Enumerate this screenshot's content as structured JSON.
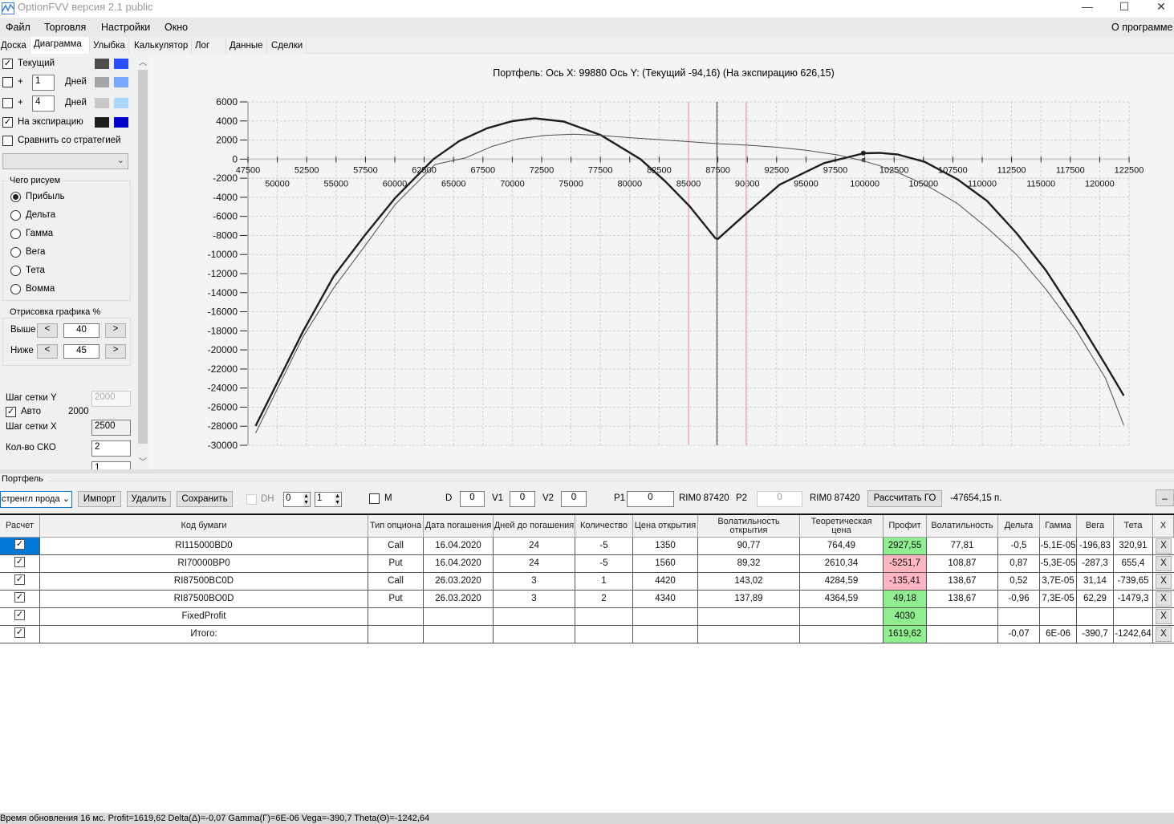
{
  "window": {
    "title": "OptionFVV версия 2.1 public",
    "minimize": "—",
    "maximize": "☐",
    "close": "✕"
  },
  "menu": {
    "items": [
      "Файл",
      "Торговля",
      "Настройки",
      "Окно"
    ],
    "about": "О программе"
  },
  "tabs": [
    "Доска",
    "Диаграмма",
    "Улыбка",
    "Калькулятор",
    "Лог",
    "Данные",
    "Сделки"
  ],
  "active_tab": "Диаграмма",
  "left_panel": {
    "curves": [
      {
        "checked": true,
        "label": "Текущий",
        "colors": [
          "#4d4d4d",
          "#2a4fff"
        ]
      },
      {
        "checked": false,
        "plus": "+",
        "days": "1",
        "days_label": "Дней",
        "colors": [
          "#a6a6a6",
          "#7aa7ff"
        ]
      },
      {
        "checked": false,
        "plus": "+",
        "days": "4",
        "days_label": "Дней",
        "colors": [
          "#c8c8c8",
          "#aad7ff"
        ]
      },
      {
        "checked": true,
        "label": "На экспирацию",
        "colors": [
          "#1e1e1e",
          "#0000c8"
        ]
      }
    ],
    "compare": {
      "checked": false,
      "label": "Сравнить со стратегией"
    },
    "strategy_select": "",
    "what_group": {
      "title": "Чего рисуем",
      "options": [
        "Прибыль",
        "Дельта",
        "Гамма",
        "Вега",
        "Тета",
        "Вомма"
      ],
      "selected": "Прибыль"
    },
    "draw_group": {
      "title": "Отрисовка графика %",
      "above_label": "Выше",
      "above": "40",
      "below_label": "Ниже",
      "below": "45",
      "dec": "<",
      "inc": ">"
    },
    "grid_y_label": "Шаг сетки Y",
    "grid_y": "2000",
    "auto_checked": true,
    "auto_label": "Авто",
    "auto_value": "2000",
    "grid_x_label": "Шаг сетки X",
    "grid_x": "2500",
    "sko_label": "Кол-во СКО",
    "sko": "2",
    "next_value": "1"
  },
  "chart_data": {
    "type": "line",
    "title": "Портфель: Ось X: 99880 Ось Y:  (Текущий -94,16)  (На экспирацию 626,15)",
    "xlim": [
      47500,
      122500
    ],
    "ylim": [
      -30000,
      6000
    ],
    "x_step": 2500,
    "y_step": 2000,
    "grid": true,
    "cursor_x": 99880,
    "vertical_lines": [
      {
        "x": 85000,
        "color": "#f4a0b0"
      },
      {
        "x": 89900,
        "color": "#f4a0b0"
      },
      {
        "x": 87420,
        "color": "#555a66"
      }
    ],
    "series": [
      {
        "name": "На экспирацию",
        "color": "#1e1e1e",
        "cursor_value": 626.15,
        "points": [
          [
            48150,
            -27970
          ],
          [
            52200,
            -18030
          ],
          [
            54810,
            -12250
          ],
          [
            57420,
            -8030
          ],
          [
            60030,
            -4080
          ],
          [
            63290,
            0
          ],
          [
            65500,
            1900
          ],
          [
            67860,
            3240
          ],
          [
            70000,
            3980
          ],
          [
            71900,
            4280
          ],
          [
            74380,
            3940
          ],
          [
            77515,
            2535
          ],
          [
            80900,
            0
          ],
          [
            83000,
            -2300
          ],
          [
            85080,
            -4930
          ],
          [
            87300,
            -8310
          ],
          [
            87500,
            -8370
          ],
          [
            89970,
            -5630
          ],
          [
            92750,
            -2680
          ],
          [
            96530,
            -420
          ],
          [
            99930,
            620
          ],
          [
            101300,
            650
          ],
          [
            102830,
            480
          ],
          [
            105100,
            -280
          ],
          [
            107880,
            -2110
          ],
          [
            110400,
            -4370
          ],
          [
            112920,
            -7750
          ],
          [
            115440,
            -11690
          ],
          [
            117970,
            -16480
          ],
          [
            120490,
            -21550
          ],
          [
            122050,
            -24790
          ]
        ]
      },
      {
        "name": "Текущий",
        "color": "#4d4d4d",
        "cursor_value": -94.16,
        "points": [
          [
            48150,
            -28730
          ],
          [
            52200,
            -18590
          ],
          [
            54800,
            -13500
          ],
          [
            57420,
            -9155
          ],
          [
            60000,
            -4800
          ],
          [
            63420,
            -563
          ],
          [
            66030,
            140
          ],
          [
            68200,
            1300
          ],
          [
            70470,
            2113
          ],
          [
            72800,
            2480
          ],
          [
            75170,
            2620
          ],
          [
            77500,
            2480
          ],
          [
            80000,
            2250
          ],
          [
            82500,
            2050
          ],
          [
            85080,
            1830
          ],
          [
            87690,
            1605
          ],
          [
            89970,
            1465
          ],
          [
            92500,
            1250
          ],
          [
            95020,
            930
          ],
          [
            97790,
            420
          ],
          [
            99930,
            -200
          ],
          [
            101300,
            -700
          ],
          [
            102830,
            -1410
          ],
          [
            105360,
            -2820
          ],
          [
            107880,
            -4650
          ],
          [
            110400,
            -7180
          ],
          [
            112920,
            -10000
          ],
          [
            115440,
            -13660
          ],
          [
            117970,
            -17890
          ],
          [
            120490,
            -22960
          ],
          [
            122050,
            -27890
          ]
        ]
      }
    ]
  },
  "portfolio": {
    "title": "Портфель",
    "strategy": "стренгл прода",
    "import": "Импорт",
    "delete": "Удалить",
    "save": "Сохранить",
    "dh_label": "DH",
    "dh_checked": false,
    "spin1": "0",
    "spin2": "1",
    "m_label": "M",
    "m_checked": false,
    "d_label": "D",
    "d": "0",
    "v1_label": "V1",
    "v1": "0",
    "v2_label": "V2",
    "v2": "0",
    "p1_label": "P1",
    "p1": "0",
    "p1_ticker": "RIM0 87420",
    "p2_label": "P2",
    "p2": "0",
    "p2_ticker": "RIM0 87420",
    "calc_go": "Рассчитать ГО",
    "go_value": "-47654,15 п.",
    "collapse": "_"
  },
  "table": {
    "headers": [
      "Расчет",
      "Код бумаги",
      "Тип опциона",
      "Дата погашения",
      "Дней до погашения",
      "Количество",
      "Цена открытия",
      "Волатильность открытия",
      "Теоретическая цена",
      "Профит",
      "Волатильность",
      "Дельта",
      "Гамма",
      "Вега",
      "Тета",
      "X"
    ],
    "rows": [
      {
        "checked": true,
        "cells": [
          "RI115000BD0",
          "Call",
          "16.04.2020",
          "24",
          "-5",
          "1350",
          "90,77",
          "764,49",
          "2927,55",
          "77,81",
          "-0,5",
          "-5,1E-05",
          "-196,83",
          "320,91"
        ],
        "profit_status": "pos"
      },
      {
        "checked": true,
        "cells": [
          "RI70000BP0",
          "Put",
          "16.04.2020",
          "24",
          "-5",
          "1560",
          "89,32",
          "2610,34",
          "-5251,7",
          "108,87",
          "0,87",
          "-5,3E-05",
          "-287,3",
          "655,4"
        ],
        "profit_status": "neg"
      },
      {
        "checked": true,
        "cells": [
          "RI87500BC0D",
          "Call",
          "26.03.2020",
          "3",
          "1",
          "4420",
          "143,02",
          "4284,59",
          "-135,41",
          "138,67",
          "0,52",
          "3,7E-05",
          "31,14",
          "-739,65"
        ],
        "profit_status": "neg"
      },
      {
        "checked": true,
        "cells": [
          "RI87500BO0D",
          "Put",
          "26.03.2020",
          "3",
          "2",
          "4340",
          "137,89",
          "4364,59",
          "49,18",
          "138,67",
          "-0,96",
          "7,3E-05",
          "62,29",
          "-1479,3"
        ],
        "profit_status": "pos"
      },
      {
        "checked": true,
        "cells": [
          "FixedProfit",
          "",
          "",
          "",
          "",
          "",
          "",
          "",
          "4030",
          "",
          "",
          "",
          "",
          ""
        ],
        "profit_status": "pos"
      },
      {
        "checked": true,
        "cells": [
          "Итого:",
          "",
          "",
          "",
          "",
          "",
          "",
          "",
          "1619,62",
          "",
          "-0,07",
          "6E-06",
          "-390,7",
          "-1242,64"
        ],
        "profit_status": "pos"
      }
    ],
    "delete_label": "X"
  },
  "status": "Время обновления 16 мс. Profit=1619,62 Delta(Δ)=-0,07 Gamma(Γ)=6E-06 Vega=-390,7 Theta(Θ)=-1242,64"
}
